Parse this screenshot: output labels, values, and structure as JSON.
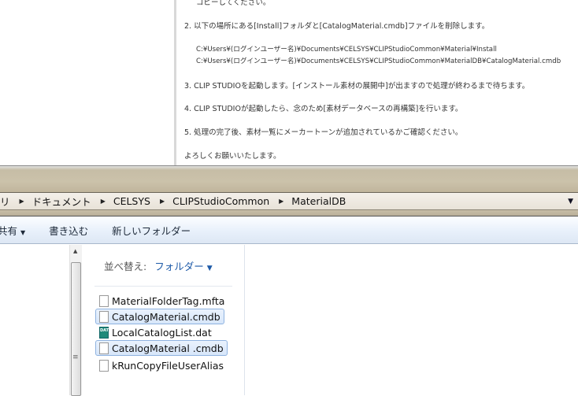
{
  "document": {
    "lines": [
      "コピーしてください。",
      "2. 以下の場所にある[Install]フォルダと[CatalogMaterial.cmdb]ファイルを削除します。",
      "C:¥Users¥(ログインユーザー名)¥Documents¥CELSYS¥CLIPStudioCommon¥Material¥Install",
      "C:¥Users¥(ログインユーザー名)¥Documents¥CELSYS¥CLIPStudioCommon¥MaterialDB¥CatalogMaterial.cmdb",
      "3. CLIP STUDIOを起動します。[インストール素材の展開中]が出ますので処理が終わるまで待ちます。",
      "4. CLIP STUDIOが起動したら、念のため[素材データベースの再構築]を行います。",
      "5. 処理の完了後、素材一覧にメーカートーンが追加されているかご確認ください。",
      "よろしくお願いいたします。"
    ]
  },
  "explorer": {
    "breadcrumb": [
      "リ",
      "ドキュメント",
      "CELSYS",
      "CLIPStudioCommon",
      "MaterialDB"
    ],
    "toolbar": {
      "share": "共有",
      "share_arrow": "▼",
      "burn": "書き込む",
      "new_folder": "新しいフォルダー"
    },
    "sort": {
      "label": "並べ替え:",
      "value": "フォルダー",
      "arrow": "▼"
    },
    "files": [
      {
        "name": "MaterialFolderTag.mfta",
        "icon": "file-icon",
        "selected": false
      },
      {
        "name": "CatalogMaterial.cmdb",
        "icon": "file-icon",
        "selected": true
      },
      {
        "name": "LocalCatalogList.dat",
        "icon": "dat-file-icon",
        "selected": false,
        "badge": "DAT"
      },
      {
        "name": "CatalogMaterial .cmdb",
        "icon": "file-icon",
        "selected": true
      },
      {
        "name": "kRunCopyFileUserAlias",
        "icon": "file-icon",
        "selected": false
      }
    ]
  }
}
